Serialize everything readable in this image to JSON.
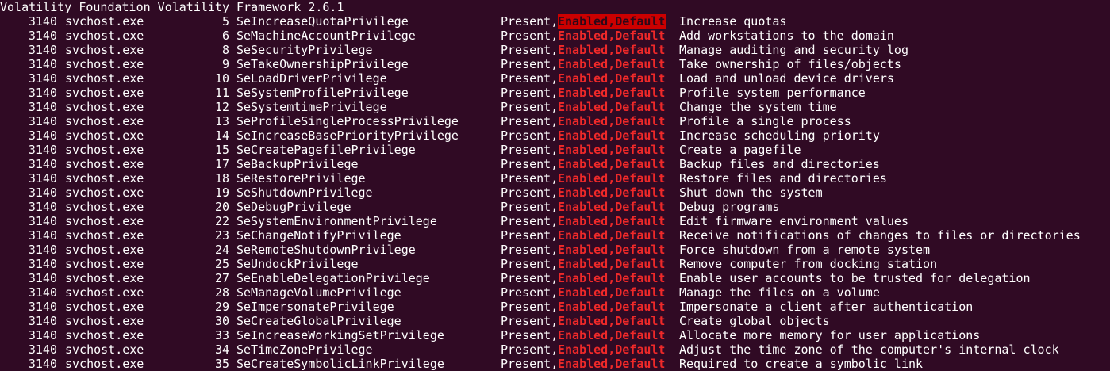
{
  "colors": {
    "background": "#300a24",
    "foreground": "#ffffff",
    "attrs_text": "#ef2929",
    "highlight_bg": "#cc0000"
  },
  "header": {
    "text": "Volatility Foundation Volatility Framework 2.6.1"
  },
  "rows": [
    {
      "pid": "3140",
      "process": "svchost.exe",
      "value": "5",
      "privilege": "SeIncreaseQuotaPrivilege",
      "present": "Present,",
      "attributes": "Enabled,Default",
      "description": "Increase quotas",
      "highlighted": true
    },
    {
      "pid": "3140",
      "process": "svchost.exe",
      "value": "6",
      "privilege": "SeMachineAccountPrivilege",
      "present": "Present,",
      "attributes": "Enabled,Default",
      "description": "Add workstations to the domain"
    },
    {
      "pid": "3140",
      "process": "svchost.exe",
      "value": "8",
      "privilege": "SeSecurityPrivilege",
      "present": "Present,",
      "attributes": "Enabled,Default",
      "description": "Manage auditing and security log"
    },
    {
      "pid": "3140",
      "process": "svchost.exe",
      "value": "9",
      "privilege": "SeTakeOwnershipPrivilege",
      "present": "Present,",
      "attributes": "Enabled,Default",
      "description": "Take ownership of files/objects"
    },
    {
      "pid": "3140",
      "process": "svchost.exe",
      "value": "10",
      "privilege": "SeLoadDriverPrivilege",
      "present": "Present,",
      "attributes": "Enabled,Default",
      "description": "Load and unload device drivers"
    },
    {
      "pid": "3140",
      "process": "svchost.exe",
      "value": "11",
      "privilege": "SeSystemProfilePrivilege",
      "present": "Present,",
      "attributes": "Enabled,Default",
      "description": "Profile system performance"
    },
    {
      "pid": "3140",
      "process": "svchost.exe",
      "value": "12",
      "privilege": "SeSystemtimePrivilege",
      "present": "Present,",
      "attributes": "Enabled,Default",
      "description": "Change the system time"
    },
    {
      "pid": "3140",
      "process": "svchost.exe",
      "value": "13",
      "privilege": "SeProfileSingleProcessPrivilege",
      "present": "Present,",
      "attributes": "Enabled,Default",
      "description": "Profile a single process"
    },
    {
      "pid": "3140",
      "process": "svchost.exe",
      "value": "14",
      "privilege": "SeIncreaseBasePriorityPrivilege",
      "present": "Present,",
      "attributes": "Enabled,Default",
      "description": "Increase scheduling priority"
    },
    {
      "pid": "3140",
      "process": "svchost.exe",
      "value": "15",
      "privilege": "SeCreatePagefilePrivilege",
      "present": "Present,",
      "attributes": "Enabled,Default",
      "description": "Create a pagefile"
    },
    {
      "pid": "3140",
      "process": "svchost.exe",
      "value": "17",
      "privilege": "SeBackupPrivilege",
      "present": "Present,",
      "attributes": "Enabled,Default",
      "description": "Backup files and directories"
    },
    {
      "pid": "3140",
      "process": "svchost.exe",
      "value": "18",
      "privilege": "SeRestorePrivilege",
      "present": "Present,",
      "attributes": "Enabled,Default",
      "description": "Restore files and directories"
    },
    {
      "pid": "3140",
      "process": "svchost.exe",
      "value": "19",
      "privilege": "SeShutdownPrivilege",
      "present": "Present,",
      "attributes": "Enabled,Default",
      "description": "Shut down the system"
    },
    {
      "pid": "3140",
      "process": "svchost.exe",
      "value": "20",
      "privilege": "SeDebugPrivilege",
      "present": "Present,",
      "attributes": "Enabled,Default",
      "description": "Debug programs"
    },
    {
      "pid": "3140",
      "process": "svchost.exe",
      "value": "22",
      "privilege": "SeSystemEnvironmentPrivilege",
      "present": "Present,",
      "attributes": "Enabled,Default",
      "description": "Edit firmware environment values"
    },
    {
      "pid": "3140",
      "process": "svchost.exe",
      "value": "23",
      "privilege": "SeChangeNotifyPrivilege",
      "present": "Present,",
      "attributes": "Enabled,Default",
      "description": "Receive notifications of changes to files or directories"
    },
    {
      "pid": "3140",
      "process": "svchost.exe",
      "value": "24",
      "privilege": "SeRemoteShutdownPrivilege",
      "present": "Present,",
      "attributes": "Enabled,Default",
      "description": "Force shutdown from a remote system"
    },
    {
      "pid": "3140",
      "process": "svchost.exe",
      "value": "25",
      "privilege": "SeUndockPrivilege",
      "present": "Present,",
      "attributes": "Enabled,Default",
      "description": "Remove computer from docking station"
    },
    {
      "pid": "3140",
      "process": "svchost.exe",
      "value": "27",
      "privilege": "SeEnableDelegationPrivilege",
      "present": "Present,",
      "attributes": "Enabled,Default",
      "description": "Enable user accounts to be trusted for delegation"
    },
    {
      "pid": "3140",
      "process": "svchost.exe",
      "value": "28",
      "privilege": "SeManageVolumePrivilege",
      "present": "Present,",
      "attributes": "Enabled,Default",
      "description": "Manage the files on a volume"
    },
    {
      "pid": "3140",
      "process": "svchost.exe",
      "value": "29",
      "privilege": "SeImpersonatePrivilege",
      "present": "Present,",
      "attributes": "Enabled,Default",
      "description": "Impersonate a client after authentication"
    },
    {
      "pid": "3140",
      "process": "svchost.exe",
      "value": "30",
      "privilege": "SeCreateGlobalPrivilege",
      "present": "Present,",
      "attributes": "Enabled,Default",
      "description": "Create global objects"
    },
    {
      "pid": "3140",
      "process": "svchost.exe",
      "value": "33",
      "privilege": "SeIncreaseWorkingSetPrivilege",
      "present": "Present,",
      "attributes": "Enabled,Default",
      "description": "Allocate more memory for user applications"
    },
    {
      "pid": "3140",
      "process": "svchost.exe",
      "value": "34",
      "privilege": "SeTimeZonePrivilege",
      "present": "Present,",
      "attributes": "Enabled,Default",
      "description": "Adjust the time zone of the computer's internal clock"
    },
    {
      "pid": "3140",
      "process": "svchost.exe",
      "value": "35",
      "privilege": "SeCreateSymbolicLinkPrivilege",
      "present": "Present,",
      "attributes": "Enabled,Default",
      "description": "Required to create a symbolic link"
    }
  ]
}
